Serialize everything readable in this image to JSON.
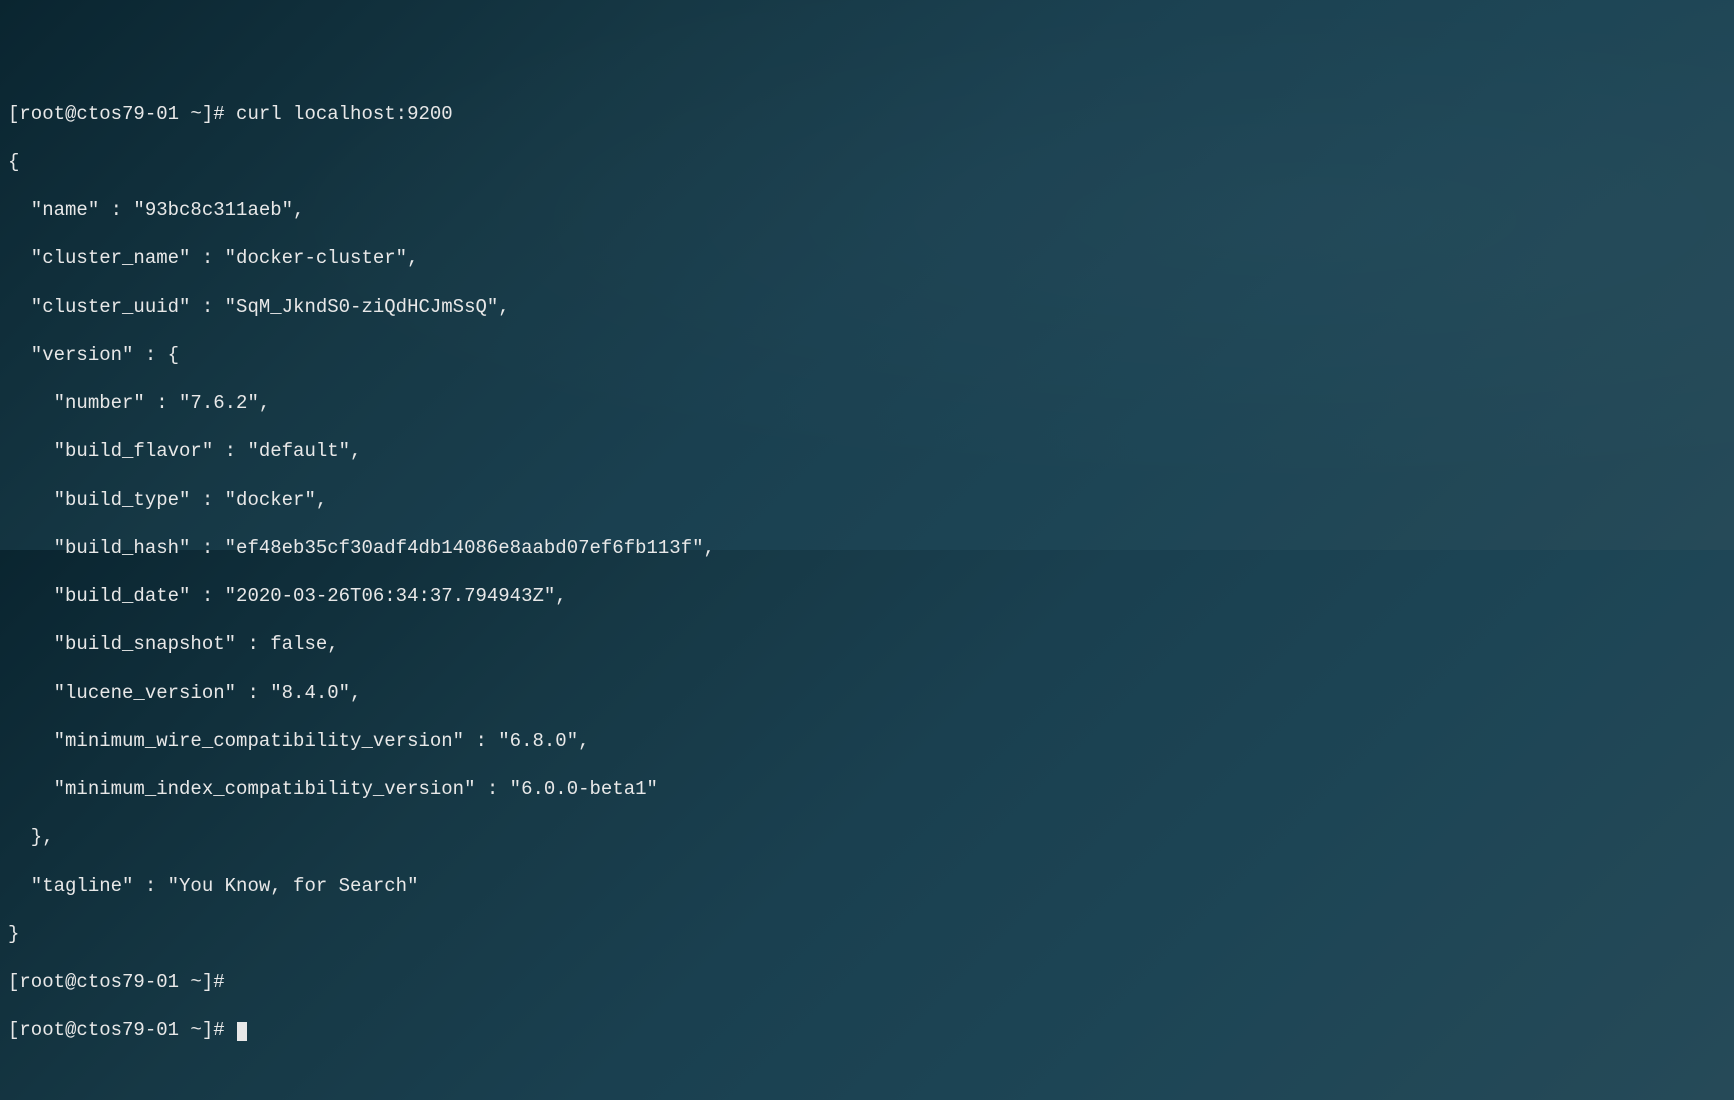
{
  "prompt": {
    "user": "root",
    "host": "ctos79-01",
    "path": "~",
    "symbol": "#"
  },
  "command": "curl localhost:9200",
  "response": {
    "name": "93bc8c311aeb",
    "cluster_name": "docker-cluster",
    "cluster_uuid": "SqM_JkndS0-ziQdHCJmSsQ",
    "version": {
      "number": "7.6.2",
      "build_flavor": "default",
      "build_type": "docker",
      "build_hash": "ef48eb35cf30adf4db14086e8aabd07ef6fb113f",
      "build_date": "2020-03-26T06:34:37.794943Z",
      "build_snapshot": "false",
      "lucene_version": "8.4.0",
      "minimum_wire_compatibility_version": "6.8.0",
      "minimum_index_compatibility_version": "6.0.0-beta1"
    },
    "tagline": "You Know, for Search"
  },
  "lines": {
    "l0": "[root@ctos79-01 ~]# curl localhost:9200",
    "l1": "{",
    "l2": "  \"name\" : \"93bc8c311aeb\",",
    "l3": "  \"cluster_name\" : \"docker-cluster\",",
    "l4": "  \"cluster_uuid\" : \"SqM_JkndS0-ziQdHCJmSsQ\",",
    "l5": "  \"version\" : {",
    "l6": "    \"number\" : \"7.6.2\",",
    "l7": "    \"build_flavor\" : \"default\",",
    "l8": "    \"build_type\" : \"docker\",",
    "l9": "    \"build_hash\" : \"ef48eb35cf30adf4db14086e8aabd07ef6fb113f\",",
    "l10": "    \"build_date\" : \"2020-03-26T06:34:37.794943Z\",",
    "l11": "    \"build_snapshot\" : false,",
    "l12": "    \"lucene_version\" : \"8.4.0\",",
    "l13": "    \"minimum_wire_compatibility_version\" : \"6.8.0\",",
    "l14": "    \"minimum_index_compatibility_version\" : \"6.0.0-beta1\"",
    "l15": "  },",
    "l16": "  \"tagline\" : \"You Know, for Search\"",
    "l17": "}",
    "l18": "[root@ctos79-01 ~]# ",
    "l19": "[root@ctos79-01 ~]# "
  }
}
